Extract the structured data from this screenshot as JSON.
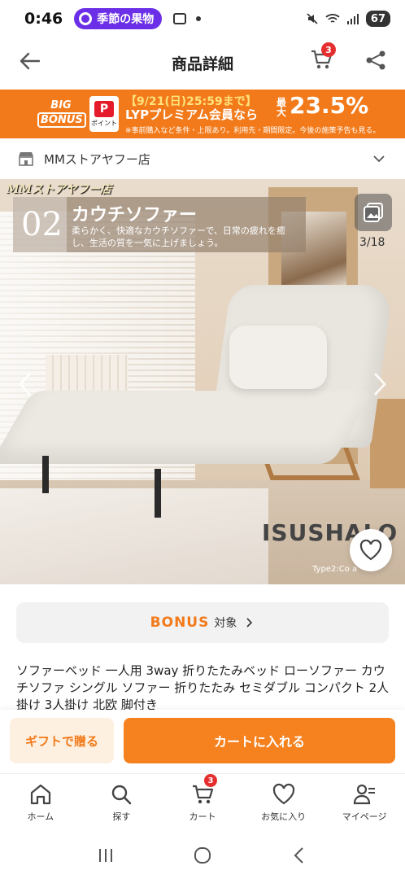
{
  "status": {
    "time": "0:46",
    "pill_text": "季節の果物",
    "battery": "67"
  },
  "header": {
    "title": "商品詳細",
    "cart_badge": "3"
  },
  "banner": {
    "big": "BIG",
    "bonus": "BONUS",
    "paypay": "ポイント",
    "deadline": "【9/21(日)25:59まで】",
    "max_label": "最大",
    "percent": "23.5%",
    "program": "LYPプレミアム会員なら",
    "note": "※事前購入など条件・上限あり。利用先・期間限定。今後の施策予告も見る。"
  },
  "store": {
    "name": "MMストアヤフー店"
  },
  "product_image": {
    "brand_label": "MMストアヤフー店",
    "feature_num": "02",
    "feature_title": "カウチソファー",
    "feature_desc": "柔らかく、快適なカウチソファーで、日常の疲れを癒し、生活の質を一気に上げましょう。",
    "counter": "3/18",
    "brand_stamp": "ISUSHALO",
    "type_label": "Type2:Co       a"
  },
  "bonus": {
    "word": "BONUS",
    "target": "対象"
  },
  "product": {
    "title": "ソファーベッド 一人用 3way 折りたたみベッド ローソファー カウチソファ シングル ソファー 折りたたみ セミダブル コンパクト 2人掛け 3人掛け 北欧 脚付き"
  },
  "actions": {
    "gift": "ギフトで贈る",
    "cart": "カートに入れる"
  },
  "nav": {
    "items": [
      {
        "label": "ホーム"
      },
      {
        "label": "探す"
      },
      {
        "label": "カート",
        "badge": "3"
      },
      {
        "label": "お気に入り"
      },
      {
        "label": "マイページ"
      }
    ]
  },
  "colors": {
    "accent": "#f27a1a",
    "badge": "#e52e2e"
  }
}
